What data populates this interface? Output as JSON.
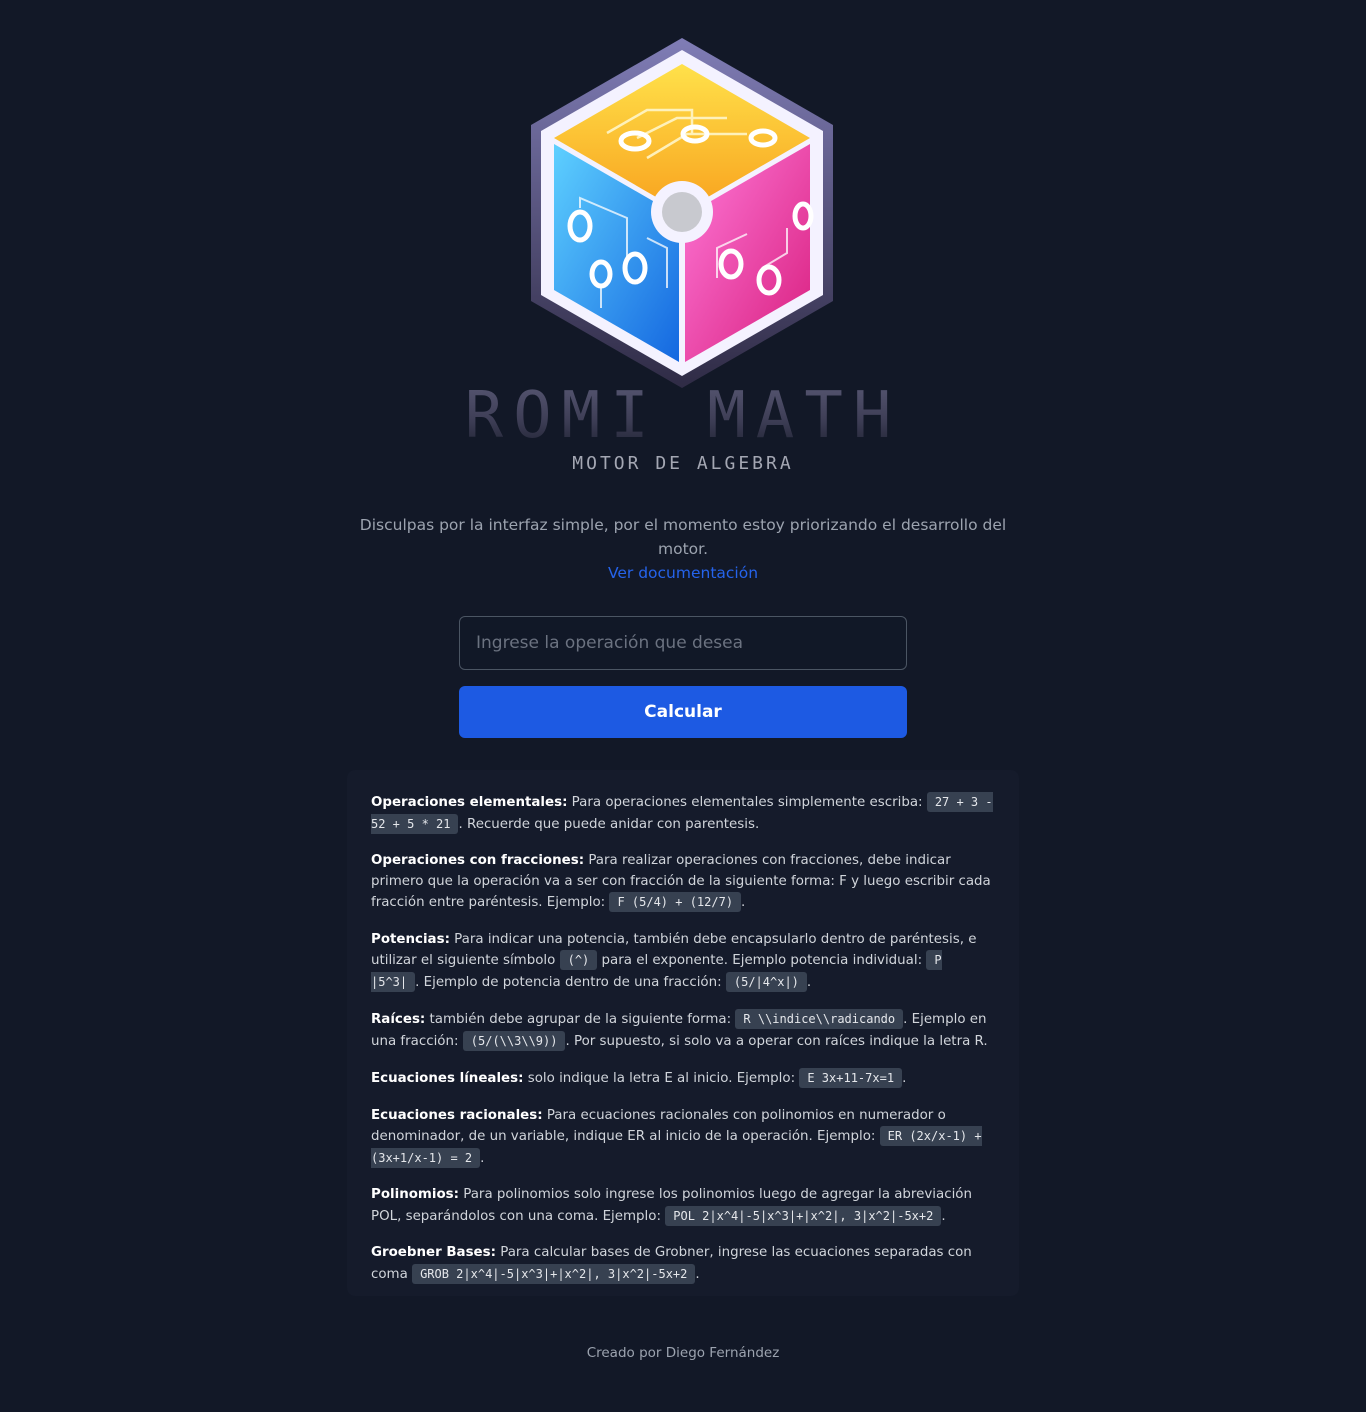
{
  "brand": {
    "title": "ROMI MATH",
    "subtitle": "MOTOR DE ALGEBRA"
  },
  "intro": {
    "apology": "Disculpas por la interfaz simple, por el momento estoy priorizando el desarrollo del motor.",
    "doc_link": "Ver documentación"
  },
  "form": {
    "placeholder": "Ingrese la operación que desea",
    "value": "",
    "submit_label": "Calcular"
  },
  "help": {
    "elementales": {
      "term": "Operaciones elementales:",
      "text1": " Para operaciones elementales simplemente escriba: ",
      "code1": "27 + 3 - 52 + 5 * 21",
      "text2": ". Recuerde que puede anidar con parentesis."
    },
    "fracciones": {
      "term": "Operaciones con fracciones:",
      "text1": " Para realizar operaciones con fracciones, debe indicar primero que la operación va a ser con fracción de la siguiente forma: F y luego escribir cada fracción entre paréntesis. Ejemplo: ",
      "code1": "F (5/4) + (12/7)",
      "text2": "."
    },
    "potencias": {
      "term": "Potencias:",
      "text1": " Para indicar una potencia, también debe encapsularlo dentro de paréntesis, e utilizar el siguiente símbolo ",
      "code1": "(^)",
      "text2": " para el exponente. Ejemplo potencia individual: ",
      "code2": "P |5^3|",
      "text3": ". Ejemplo de potencia dentro de una fracción: ",
      "code3": "(5/|4^x|)",
      "text4": "."
    },
    "raices": {
      "term": "Raíces:",
      "text1": " también debe agrupar de la siguiente forma: ",
      "code1": "R \\\\indice\\\\radicando",
      "text2": ". Ejemplo en una fracción: ",
      "code2": "(5/(\\\\3\\\\9))",
      "text3": ". Por supuesto, si solo va a operar con raíces indique la letra R."
    },
    "lineales": {
      "term": "Ecuaciones líneales:",
      "text1": " solo indique la letra E al inicio. Ejemplo: ",
      "code1": "E 3x+11-7x=1",
      "text2": "."
    },
    "racionales": {
      "term": "Ecuaciones racionales:",
      "text1": " Para ecuaciones racionales con polinomios en numerador o denominador, de un variable, indique ER al inicio de la operación. Ejemplo: ",
      "code1": "ER (2x/x-1) + (3x+1/x-1) = 2",
      "text2": "."
    },
    "polinomios": {
      "term": "Polinomios:",
      "text1": " Para polinomios solo ingrese los polinomios luego de agregar la abreviación POL, separándolos con una coma. Ejemplo: ",
      "code1": "POL 2|x^4|-5|x^3|+|x^2|, 3|x^2|-5x+2",
      "text2": "."
    },
    "groebner": {
      "term": "Groebner Bases:",
      "text1": " Para calcular bases de Grobner, ingrese las ecuaciones separadas con coma ",
      "code1": "GROB 2|x^4|-5|x^3|+|x^2|, 3|x^2|-5x+2",
      "text2": "."
    }
  },
  "footer": {
    "credit": "Creado por Diego Fernández"
  },
  "colors": {
    "background": "#121827",
    "accent": "#1d5ae3",
    "link": "#2563eb",
    "panel": "#151b2b",
    "code_bg": "#374151"
  },
  "icons": {
    "logo": "isometric-dice-cube-logo"
  }
}
